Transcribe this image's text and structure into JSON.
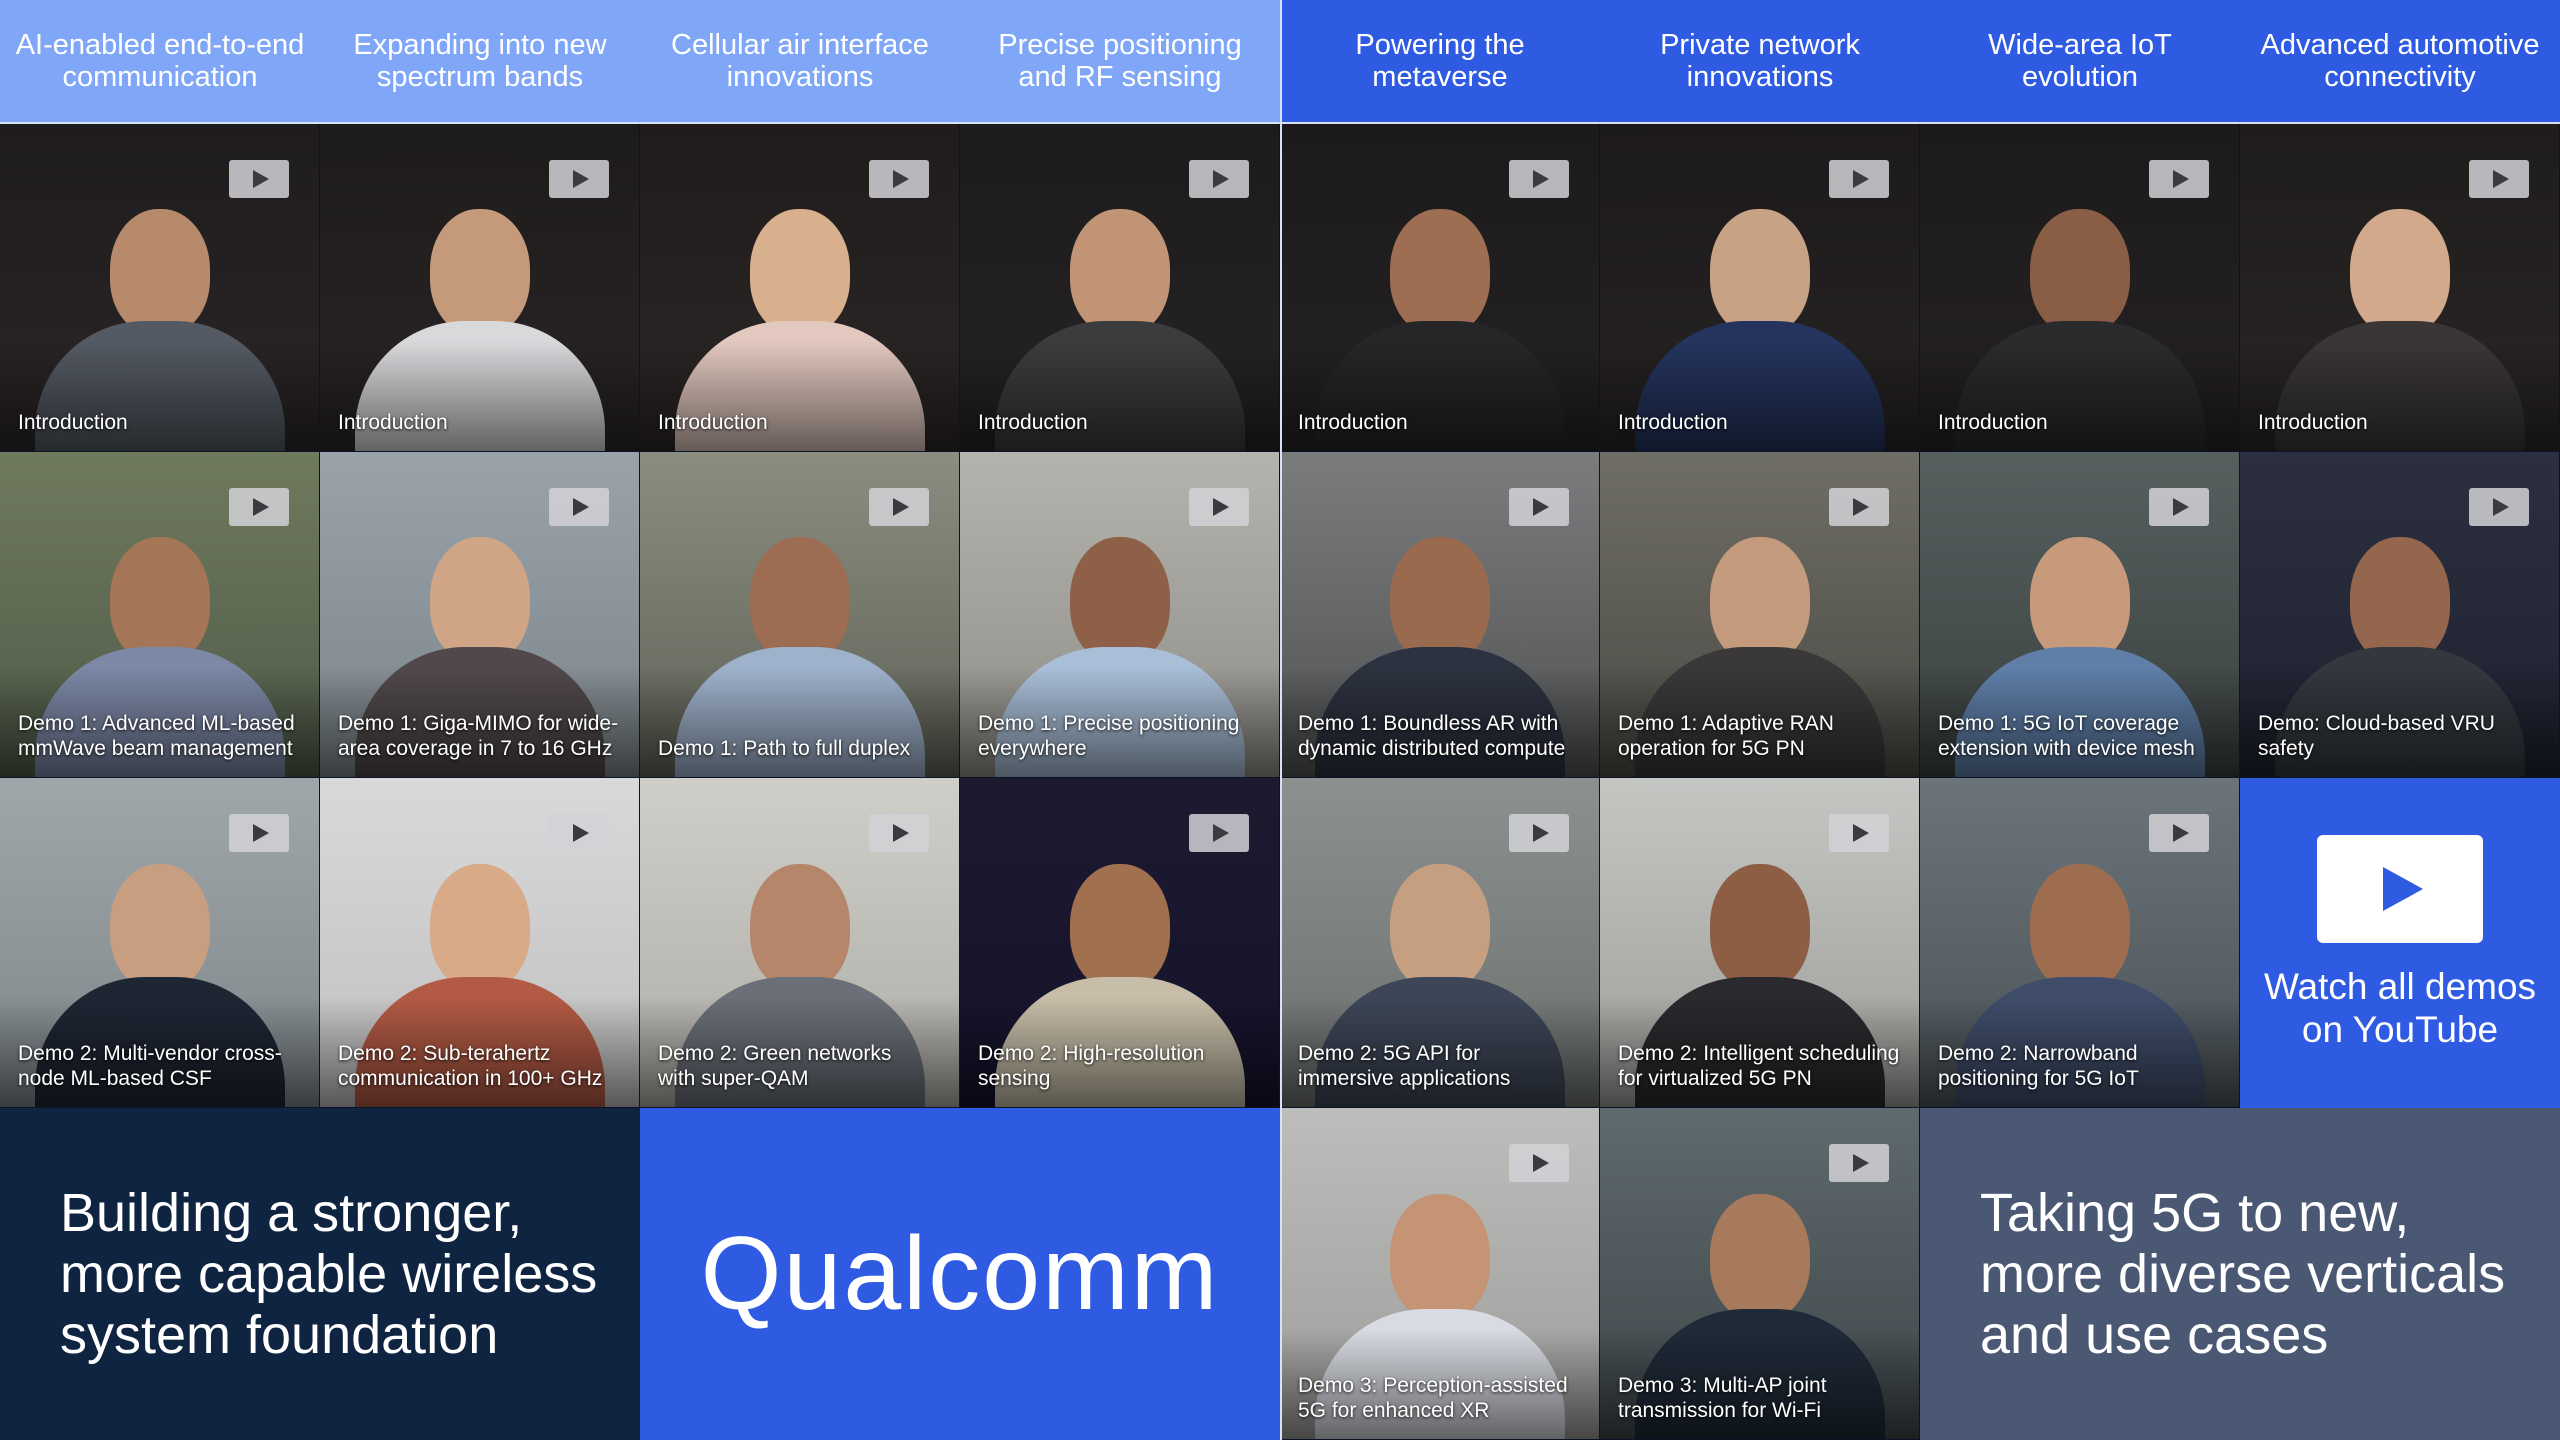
{
  "headers": [
    {
      "line1": "AI-enabled end-to-end",
      "line2": "communication",
      "tone": "light"
    },
    {
      "line1": "Expanding into new",
      "line2": "spectrum bands",
      "tone": "light"
    },
    {
      "line1": "Cellular air interface",
      "line2": "innovations",
      "tone": "light"
    },
    {
      "line1": "Precise positioning",
      "line2": "and RF sensing",
      "tone": "light"
    },
    {
      "line1": "Powering the",
      "line2": "metaverse",
      "tone": "dark"
    },
    {
      "line1": "Private network",
      "line2": "innovations",
      "tone": "dark"
    },
    {
      "line1": "Wide-area IoT",
      "line2": "evolution",
      "tone": "dark"
    },
    {
      "line1": "Advanced automotive",
      "line2": "connectivity",
      "tone": "dark"
    }
  ],
  "row_intro": [
    {
      "caption": "Introduction"
    },
    {
      "caption": "Introduction"
    },
    {
      "caption": "Introduction"
    },
    {
      "caption": "Introduction"
    },
    {
      "caption": "Introduction"
    },
    {
      "caption": "Introduction"
    },
    {
      "caption": "Introduction"
    },
    {
      "caption": "Introduction"
    }
  ],
  "row_demo1": [
    {
      "line1": "Demo 1: Advanced ML-based",
      "line2": "mmWave beam management"
    },
    {
      "line1": "Demo 1: Giga-MIMO for wide-",
      "line2": "area coverage in 7 to 16 GHz"
    },
    {
      "line1": "Demo 1: Path to full duplex",
      "line2": ""
    },
    {
      "line1": "Demo 1: Precise positioning",
      "line2": "everywhere"
    },
    {
      "line1": "Demo 1: Boundless AR with",
      "line2": "dynamic distributed compute"
    },
    {
      "line1": "Demo 1: Adaptive RAN",
      "line2": "operation for 5G PN"
    },
    {
      "line1": "Demo 1: 5G IoT coverage",
      "line2": "extension with device mesh"
    },
    {
      "line1": "Demo: Cloud-based VRU",
      "line2": "safety"
    }
  ],
  "row_demo2": [
    {
      "line1": "Demo 2: Multi-vendor cross-",
      "line2": "node ML-based CSF"
    },
    {
      "line1": "Demo 2: Sub-terahertz",
      "line2": "communication in 100+ GHz"
    },
    {
      "line1": "Demo 2: Green networks",
      "line2": "with super-QAM"
    },
    {
      "line1": "Demo 2: High-resolution",
      "line2": "sensing"
    },
    {
      "line1": "Demo 2: 5G API for",
      "line2": "immersive applications"
    },
    {
      "line1": "Demo 2: Intelligent scheduling",
      "line2": "for virtualized 5G PN"
    },
    {
      "line1": "Demo 2: Narrowband",
      "line2": "positioning for 5G IoT"
    }
  ],
  "watch_all": {
    "line1": "Watch all demos",
    "line2": "on YouTube"
  },
  "row_demo3": [
    {
      "line1": "Demo 3: Perception-assisted",
      "line2": "5G for enhanced XR"
    },
    {
      "line1": "Demo 3: Multi-AP joint",
      "line2": "transmission for Wi-Fi"
    }
  ],
  "left_panel": {
    "line1": "Building a stronger,",
    "line2": "more capable wireless",
    "line3": "system foundation"
  },
  "logo": "Qualcomm",
  "right_panel": {
    "line1": "Taking 5G to new,",
    "line2": "more diverse verticals",
    "line3": "and use cases"
  },
  "colors": {
    "light_header": "#7fa6f7",
    "dark_header": "#2f5be2",
    "brand_blue": "#2f5be2",
    "navy": "#0f2441",
    "slate": "#4a5874"
  }
}
